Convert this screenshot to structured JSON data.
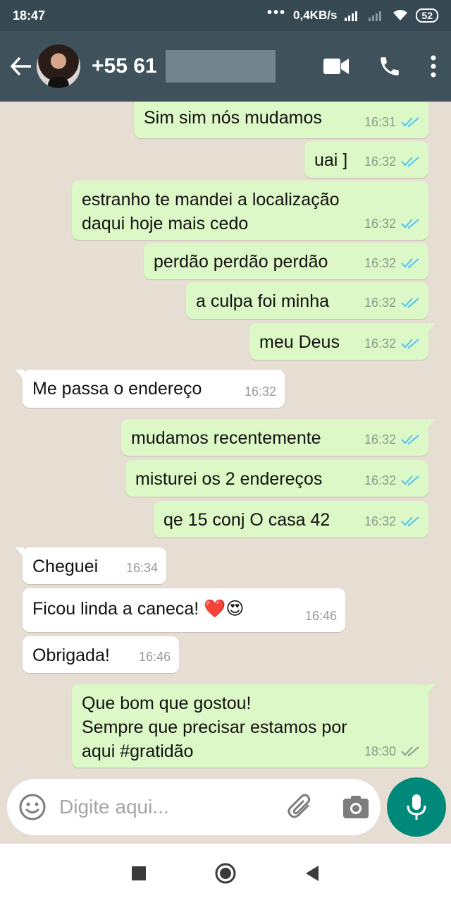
{
  "status_bar": {
    "time": "18:47",
    "dots": "•••",
    "speed": "0,4KB/s",
    "battery": "52"
  },
  "header": {
    "contact": "+55 61",
    "icons": [
      "back-arrow-icon",
      "video-call-icon",
      "phone-icon",
      "more-vert-icon"
    ]
  },
  "messages": [
    {
      "dir": "out",
      "text": "Sim sim nós mudamos",
      "time": "16:31",
      "read": true
    },
    {
      "dir": "out",
      "text": "uai ]",
      "time": "16:32",
      "read": true
    },
    {
      "dir": "out",
      "text": "estranho te mandei a localização\ndaqui hoje mais cedo",
      "time": "16:32",
      "read": true
    },
    {
      "dir": "out",
      "text": "perdão perdão perdão",
      "time": "16:32",
      "read": true
    },
    {
      "dir": "out",
      "text": "a culpa foi minha",
      "time": "16:32",
      "read": true
    },
    {
      "dir": "out",
      "text": "meu Deus",
      "time": "16:32",
      "read": true
    },
    {
      "dir": "in",
      "text": "Me passa o endereço",
      "time": "16:32"
    },
    {
      "dir": "out",
      "text": "mudamos recentemente",
      "time": "16:32",
      "read": true
    },
    {
      "dir": "out",
      "text": "misturei os 2 endereços",
      "time": "16:32",
      "read": true
    },
    {
      "dir": "out",
      "text": "qe 15 conj O casa 42",
      "time": "16:32",
      "read": true
    },
    {
      "dir": "in",
      "text": "Cheguei",
      "time": "16:34"
    },
    {
      "dir": "in",
      "text": "Ficou linda a caneca! ❤️😍",
      "time": "16:46"
    },
    {
      "dir": "in",
      "text": "Obrigada!",
      "time": "16:46"
    },
    {
      "dir": "out",
      "text": "Que bom que gostou!\nSempre que precisar estamos por\naqui #gratidão",
      "time": "18:30",
      "read": false
    }
  ],
  "input": {
    "placeholder": "Digite aqui..."
  },
  "colors": {
    "header": "#3f525c",
    "status_bar": "#364851",
    "outgoing": "#dcf8c6",
    "incoming": "#ffffff",
    "read_tick": "#4fc3f7",
    "mic": "#00897b"
  }
}
